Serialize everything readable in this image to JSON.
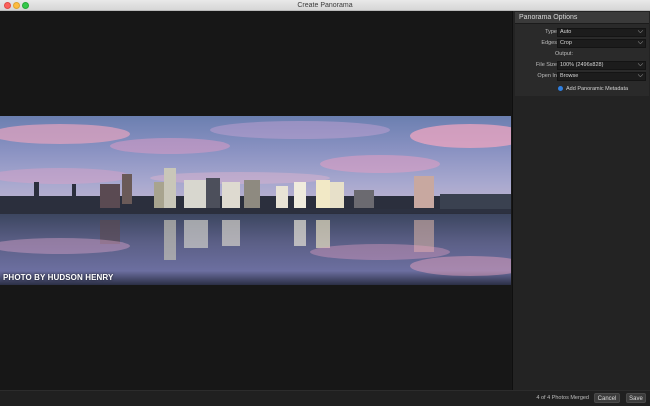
{
  "window": {
    "title": "Create Panorama"
  },
  "preview": {
    "credit": "PHOTO BY HUDSON HENRY"
  },
  "panel": {
    "title": "Panorama Options",
    "type": {
      "label": "Type",
      "value": "Auto"
    },
    "edges": {
      "label": "Edges",
      "value": "Crop"
    },
    "output_label": "Output:",
    "file_size": {
      "label": "File Size",
      "value": "100% (2496x828)"
    },
    "open_in": {
      "label": "Open In",
      "value": "Browse"
    },
    "metadata_label": "Add Panoramic Metadata",
    "metadata_checked": true
  },
  "footer": {
    "status": "4 of 4 Photos Merged",
    "cancel_label": "Cancel",
    "save_label": "Save"
  },
  "colors": {
    "accent": "#2f7fe0",
    "panel_bg": "#232323",
    "preview_bg": "#171717"
  },
  "icons": {
    "dropdown": "chevron-down-icon",
    "checkbox": "checkbox-checked-icon"
  }
}
